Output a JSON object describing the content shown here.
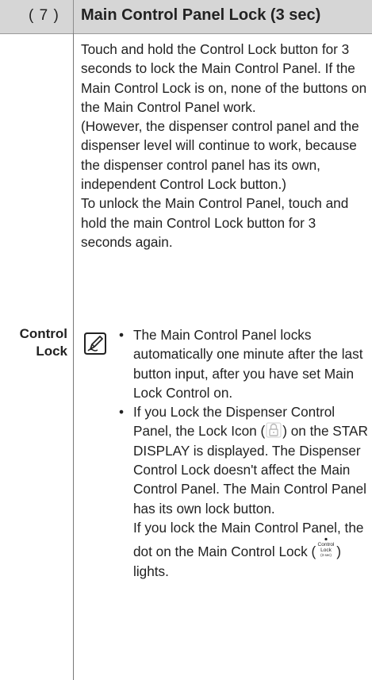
{
  "header": {
    "number": "( 7 )",
    "title": "Main Control Panel Lock (3 sec)"
  },
  "intro": {
    "p1": "Touch and hold the Control Lock button for 3 seconds to lock the Main Control Panel. If the Main Control Lock is on, none of the buttons on the Main Control Panel work.",
    "p2": "(However, the dispenser control panel and the dispenser level will continue to work, because the dispenser control panel has its own, independent Control Lock button.)",
    "p3": "To unlock the Main Control Panel, touch and hold the main Control Lock button for 3 seconds again."
  },
  "row_label": {
    "line1": "Control",
    "line2": "Lock"
  },
  "note": {
    "icon": "note-pencil-icon",
    "bullet1": "The Main Control Panel locks automatically one minute after the last button input, after you have set Main Lock Control on.",
    "bullet2_before": "If you Lock the Dispenser Control Panel, the Lock Icon (",
    "bullet2_after": ") on the STAR DISPLAY is displayed. The Dispenser Control Lock doesn't affect the Main Control Panel. The Main Control Panel has its own lock button.",
    "bullet2_p2_before": "If you lock the Main Control Panel, the dot on the Main Control Lock (",
    "bullet2_p2_after": ") lights."
  },
  "lock_icon": "padlock-icon",
  "control_lock_button": {
    "line1": "Control",
    "line2": "Lock",
    "line3": "(3 sec)"
  }
}
